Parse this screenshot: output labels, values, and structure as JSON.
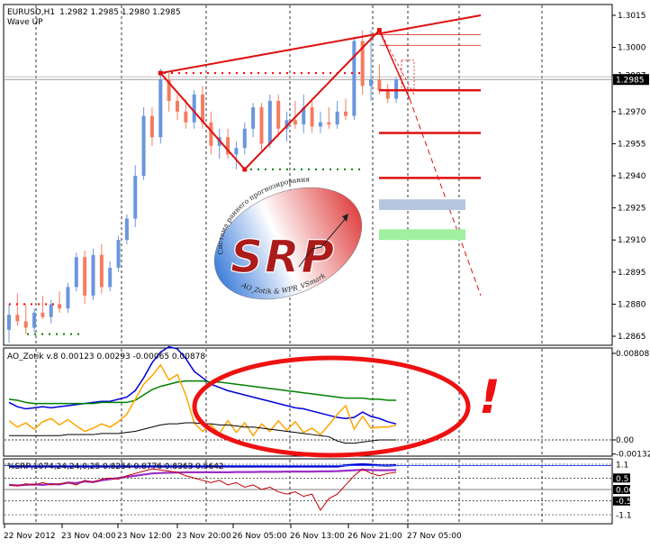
{
  "chart_data": [
    {
      "type": "candlestick",
      "title": "EURUSD,H1",
      "ohlc": "1.2982 1.2985 1.2980 1.2985",
      "indicator": "Wave UP",
      "current_price_label": "1.2985",
      "y_ticks": [
        "1.3015",
        "1.3000",
        "1.2987",
        "1.2985",
        "1.2970",
        "1.2955",
        "1.2940",
        "1.2925",
        "1.2910",
        "1.2895",
        "1.2880",
        "1.2865"
      ],
      "x_ticks": [
        "22 Nov 2012",
        "23 Nov 04:00",
        "23 Nov 12:00",
        "23 Nov 20:00",
        "26 Nov 05:00",
        "26 Nov 13:00",
        "26 Nov 21:00",
        "27 Nov 05:00"
      ],
      "ylim": [
        1.2862,
        1.302
      ],
      "series": [
        {
          "values": [
            [
              1.2868,
              1.288,
              1.2862,
              1.2875
            ],
            [
              1.2875,
              1.2885,
              1.287,
              1.2872
            ],
            [
              1.2872,
              1.288,
              1.2866,
              1.2869
            ],
            [
              1.2869,
              1.2878,
              1.2867,
              1.2876
            ],
            [
              1.2876,
              1.2884,
              1.2873,
              1.2874
            ],
            [
              1.2874,
              1.2882,
              1.2871,
              1.288
            ],
            [
              1.288,
              1.2886,
              1.2876,
              1.2878
            ],
            [
              1.2878,
              1.289,
              1.2876,
              1.2888
            ],
            [
              1.2888,
              1.2904,
              1.2886,
              1.2902
            ],
            [
              1.2902,
              1.2905,
              1.288,
              1.2884
            ],
            [
              1.2884,
              1.2906,
              1.2882,
              1.2903
            ],
            [
              1.2903,
              1.2908,
              1.2885,
              1.2888
            ],
            [
              1.2888,
              1.29,
              1.2886,
              1.2897
            ],
            [
              1.2897,
              1.2912,
              1.2895,
              1.291
            ],
            [
              1.291,
              1.2922,
              1.2908,
              1.292
            ],
            [
              1.292,
              1.2945,
              1.2916,
              1.294
            ],
            [
              1.294,
              1.2972,
              1.2938,
              1.2968
            ],
            [
              1.2968,
              1.2972,
              1.2954,
              1.2958
            ],
            [
              1.2958,
              1.299,
              1.2955,
              1.2985
            ],
            [
              1.2985,
              1.2988,
              1.297,
              1.2975
            ],
            [
              1.2975,
              1.2978,
              1.2966,
              1.297
            ],
            [
              1.297,
              1.2976,
              1.2962,
              1.2965
            ],
            [
              1.2965,
              1.298,
              1.2962,
              1.2978
            ],
            [
              1.2978,
              1.2982,
              1.2962,
              1.2965
            ],
            [
              1.2965,
              1.297,
              1.295,
              1.2954
            ],
            [
              1.2954,
              1.2962,
              1.2948,
              1.2958
            ],
            [
              1.2958,
              1.2962,
              1.2948,
              1.295
            ],
            [
              1.295,
              1.2956,
              1.2943,
              1.2953
            ],
            [
              1.2953,
              1.2965,
              1.295,
              1.2962
            ],
            [
              1.2962,
              1.2974,
              1.2958,
              1.2972
            ],
            [
              1.2972,
              1.2974,
              1.2952,
              1.2955
            ],
            [
              1.2955,
              1.2978,
              1.2953,
              1.2975
            ],
            [
              1.2975,
              1.2978,
              1.2958,
              1.2962
            ],
            [
              1.2962,
              1.297,
              1.2956,
              1.2966
            ],
            [
              1.2966,
              1.2975,
              1.2962,
              1.2964
            ],
            [
              1.2964,
              1.2978,
              1.296,
              1.2972
            ],
            [
              1.2972,
              1.2975,
              1.296,
              1.2963
            ],
            [
              1.2963,
              1.297,
              1.296,
              1.2965
            ],
            [
              1.2965,
              1.2972,
              1.2962,
              1.2964
            ],
            [
              1.2964,
              1.2975,
              1.2962,
              1.297
            ],
            [
              1.297,
              1.2976,
              1.2966,
              1.2968
            ],
            [
              1.2968,
              1.3005,
              1.2966,
              1.3003
            ],
            [
              1.3003,
              1.3008,
              1.2978,
              1.2982
            ],
            [
              1.2982,
              1.3008,
              1.2975,
              1.2985
            ],
            [
              1.2985,
              1.2992,
              1.2978,
              1.298
            ],
            [
              1.298,
              1.2983,
              1.2974,
              1.2976
            ],
            [
              1.2976,
              1.2986,
              1.2974,
              1.2985
            ]
          ]
        }
      ],
      "levels": [
        1.298,
        1.296,
        1.2939
      ],
      "zones": [
        {
          "from": 1.2924,
          "to": 1.2929,
          "color": "#b7c6df"
        },
        {
          "from": 1.291,
          "to": 1.2915,
          "color": "#9ff09f"
        }
      ]
    },
    {
      "type": "line",
      "title": "AO_Zotik v.8 0.00123 0.00293 -0.00065 0.00878",
      "y_ticks": [
        "0.00808",
        "0.00",
        "-0.00132"
      ],
      "ylim": [
        -0.0021,
        0.0098
      ],
      "series": [
        {
          "color": "#0000dd",
          "values": [
            0.0035,
            0.0031,
            0.0029,
            0.003,
            0.0031,
            0.003,
            0.0031,
            0.0032,
            0.0033,
            0.0034,
            0.0035,
            0.0036,
            0.0036,
            0.0038,
            0.004,
            0.0046,
            0.0058,
            0.0072,
            0.0082,
            0.0087,
            0.0085,
            0.0076,
            0.0064,
            0.0058,
            0.0052,
            0.0049,
            0.0046,
            0.0044,
            0.0042,
            0.004,
            0.0038,
            0.0036,
            0.0034,
            0.0032,
            0.003,
            0.0029,
            0.0027,
            0.0025,
            0.0023,
            0.0021,
            0.002,
            0.0021,
            0.0026,
            0.0022,
            0.002,
            0.0017,
            0.0015
          ]
        },
        {
          "color": "#008000",
          "values": [
            0.0038,
            0.0037,
            0.0035,
            0.0034,
            0.0034,
            0.0034,
            0.0034,
            0.0034,
            0.0034,
            0.0034,
            0.0034,
            0.0035,
            0.0035,
            0.0035,
            0.0035,
            0.0037,
            0.0042,
            0.0047,
            0.005,
            0.0052,
            0.0054,
            0.0055,
            0.0055,
            0.0055,
            0.0054,
            0.0054,
            0.0053,
            0.0052,
            0.0051,
            0.005,
            0.0049,
            0.0048,
            0.0047,
            0.0046,
            0.0045,
            0.0044,
            0.0043,
            0.0042,
            0.0041,
            0.004,
            0.0039,
            0.0039,
            0.0039,
            0.0038,
            0.0038,
            0.0037,
            0.0037
          ]
        },
        {
          "color": "#ffa500",
          "values": [
            0.0018,
            0.0012,
            0.0016,
            0.001,
            0.0017,
            0.002,
            0.0014,
            0.0019,
            0.0013,
            0.0008,
            0.0011,
            0.0015,
            0.0012,
            0.0017,
            0.0024,
            0.0038,
            0.0052,
            0.006,
            0.007,
            0.0056,
            0.0061,
            0.0042,
            0.0016,
            0.0008,
            0.0014,
            0.0006,
            0.0018,
            0.0007,
            0.0016,
            0.0004,
            0.0015,
            0.0008,
            0.0018,
            0.0009,
            0.0017,
            0.0007,
            0.0011,
            0.0005,
            0.0014,
            0.0024,
            0.0032,
            0.001,
            0.0022,
            0.0011,
            0.0012,
            0.0012,
            0.0014
          ]
        },
        {
          "color": "#000000",
          "values": [
            0.0004,
            0.0004,
            0.0004,
            0.0004,
            0.0004,
            0.0004,
            0.0004,
            0.0005,
            0.0005,
            0.0005,
            0.0005,
            0.0006,
            0.0006,
            0.0006,
            0.0007,
            0.0008,
            0.001,
            0.0012,
            0.0014,
            0.0015,
            0.0015,
            0.0016,
            0.0016,
            0.0015,
            0.0015,
            0.0014,
            0.0014,
            0.0013,
            0.0012,
            0.0012,
            0.0011,
            0.001,
            0.0009,
            0.0008,
            0.0007,
            0.0006,
            0.0005,
            0.0004,
            0.0003,
            -0.0001,
            -0.0003,
            -0.0003,
            -0.0002,
            -0.0001,
            0.0,
            0.0,
            0.0
          ]
        }
      ]
    },
    {
      "type": "line",
      "title": "%SRP,1074,24,24,0,25 0.8254 0.8776 0.8363 0.5642",
      "y_ticks": [
        "1.1",
        "0.5",
        "0.00",
        "-0.5",
        "-1.1"
      ],
      "ylim": [
        -1.25,
        1.25
      ],
      "series": [
        {
          "color": "#0000cc",
          "values": [
            1.0,
            1.0,
            1.0,
            1.0,
            1.0,
            1.0,
            1.0,
            1.0,
            1.0,
            1.0,
            1.0,
            1.0,
            1.0,
            1.0,
            1.0,
            1.0,
            1.0,
            1.0,
            1.0,
            1.0,
            1.0,
            1.0,
            1.0,
            1.0,
            1.0,
            1.0,
            1.0,
            1.0,
            1.0,
            1.0,
            1.0,
            1.0,
            1.0,
            1.0,
            1.0,
            1.0,
            1.0,
            1.0,
            1.0,
            1.0,
            1.05,
            1.08,
            1.1,
            1.08,
            1.05,
            1.04,
            1.06
          ]
        },
        {
          "color": "#9b30c6",
          "values": [
            0.2,
            0.18,
            0.2,
            0.22,
            0.2,
            0.24,
            0.22,
            0.3,
            0.28,
            0.35,
            0.33,
            0.4,
            0.45,
            0.5,
            0.55,
            0.6,
            0.65,
            0.7,
            0.72,
            0.73,
            0.74,
            0.75,
            0.75,
            0.75,
            0.75,
            0.75,
            0.75,
            0.76,
            0.76,
            0.76,
            0.77,
            0.77,
            0.77,
            0.78,
            0.78,
            0.78,
            0.78,
            0.79,
            0.79,
            0.8,
            0.82,
            0.84,
            0.86,
            0.85,
            0.84,
            0.84,
            0.85
          ]
        },
        {
          "color": "#c00000",
          "values": [
            0.2,
            0.15,
            0.25,
            0.2,
            0.3,
            0.2,
            0.25,
            0.3,
            0.2,
            0.4,
            0.3,
            0.45,
            0.5,
            0.45,
            0.6,
            0.7,
            0.8,
            0.9,
            0.85,
            0.8,
            0.75,
            0.6,
            0.5,
            0.4,
            0.3,
            0.4,
            0.2,
            0.3,
            0.1,
            0.2,
            0.0,
            0.1,
            -0.1,
            -0.2,
            -0.1,
            -0.3,
            -0.2,
            -0.9,
            -0.4,
            -0.2,
            0.2,
            0.6,
            0.9,
            0.7,
            0.6,
            0.7,
            0.75
          ]
        }
      ]
    }
  ],
  "annotations": {
    "logo_main": "SRP",
    "logo_top": "Система раннего прогнозирования",
    "logo_bottom": "AO_Zotik & WPR_VSmark",
    "exclamation": "!"
  },
  "colors": {
    "bull": "#6a96dd",
    "bear": "#f47c5f",
    "wave": "#dd1111",
    "dots_red": "#ff0000",
    "dots_green": "#008000"
  }
}
